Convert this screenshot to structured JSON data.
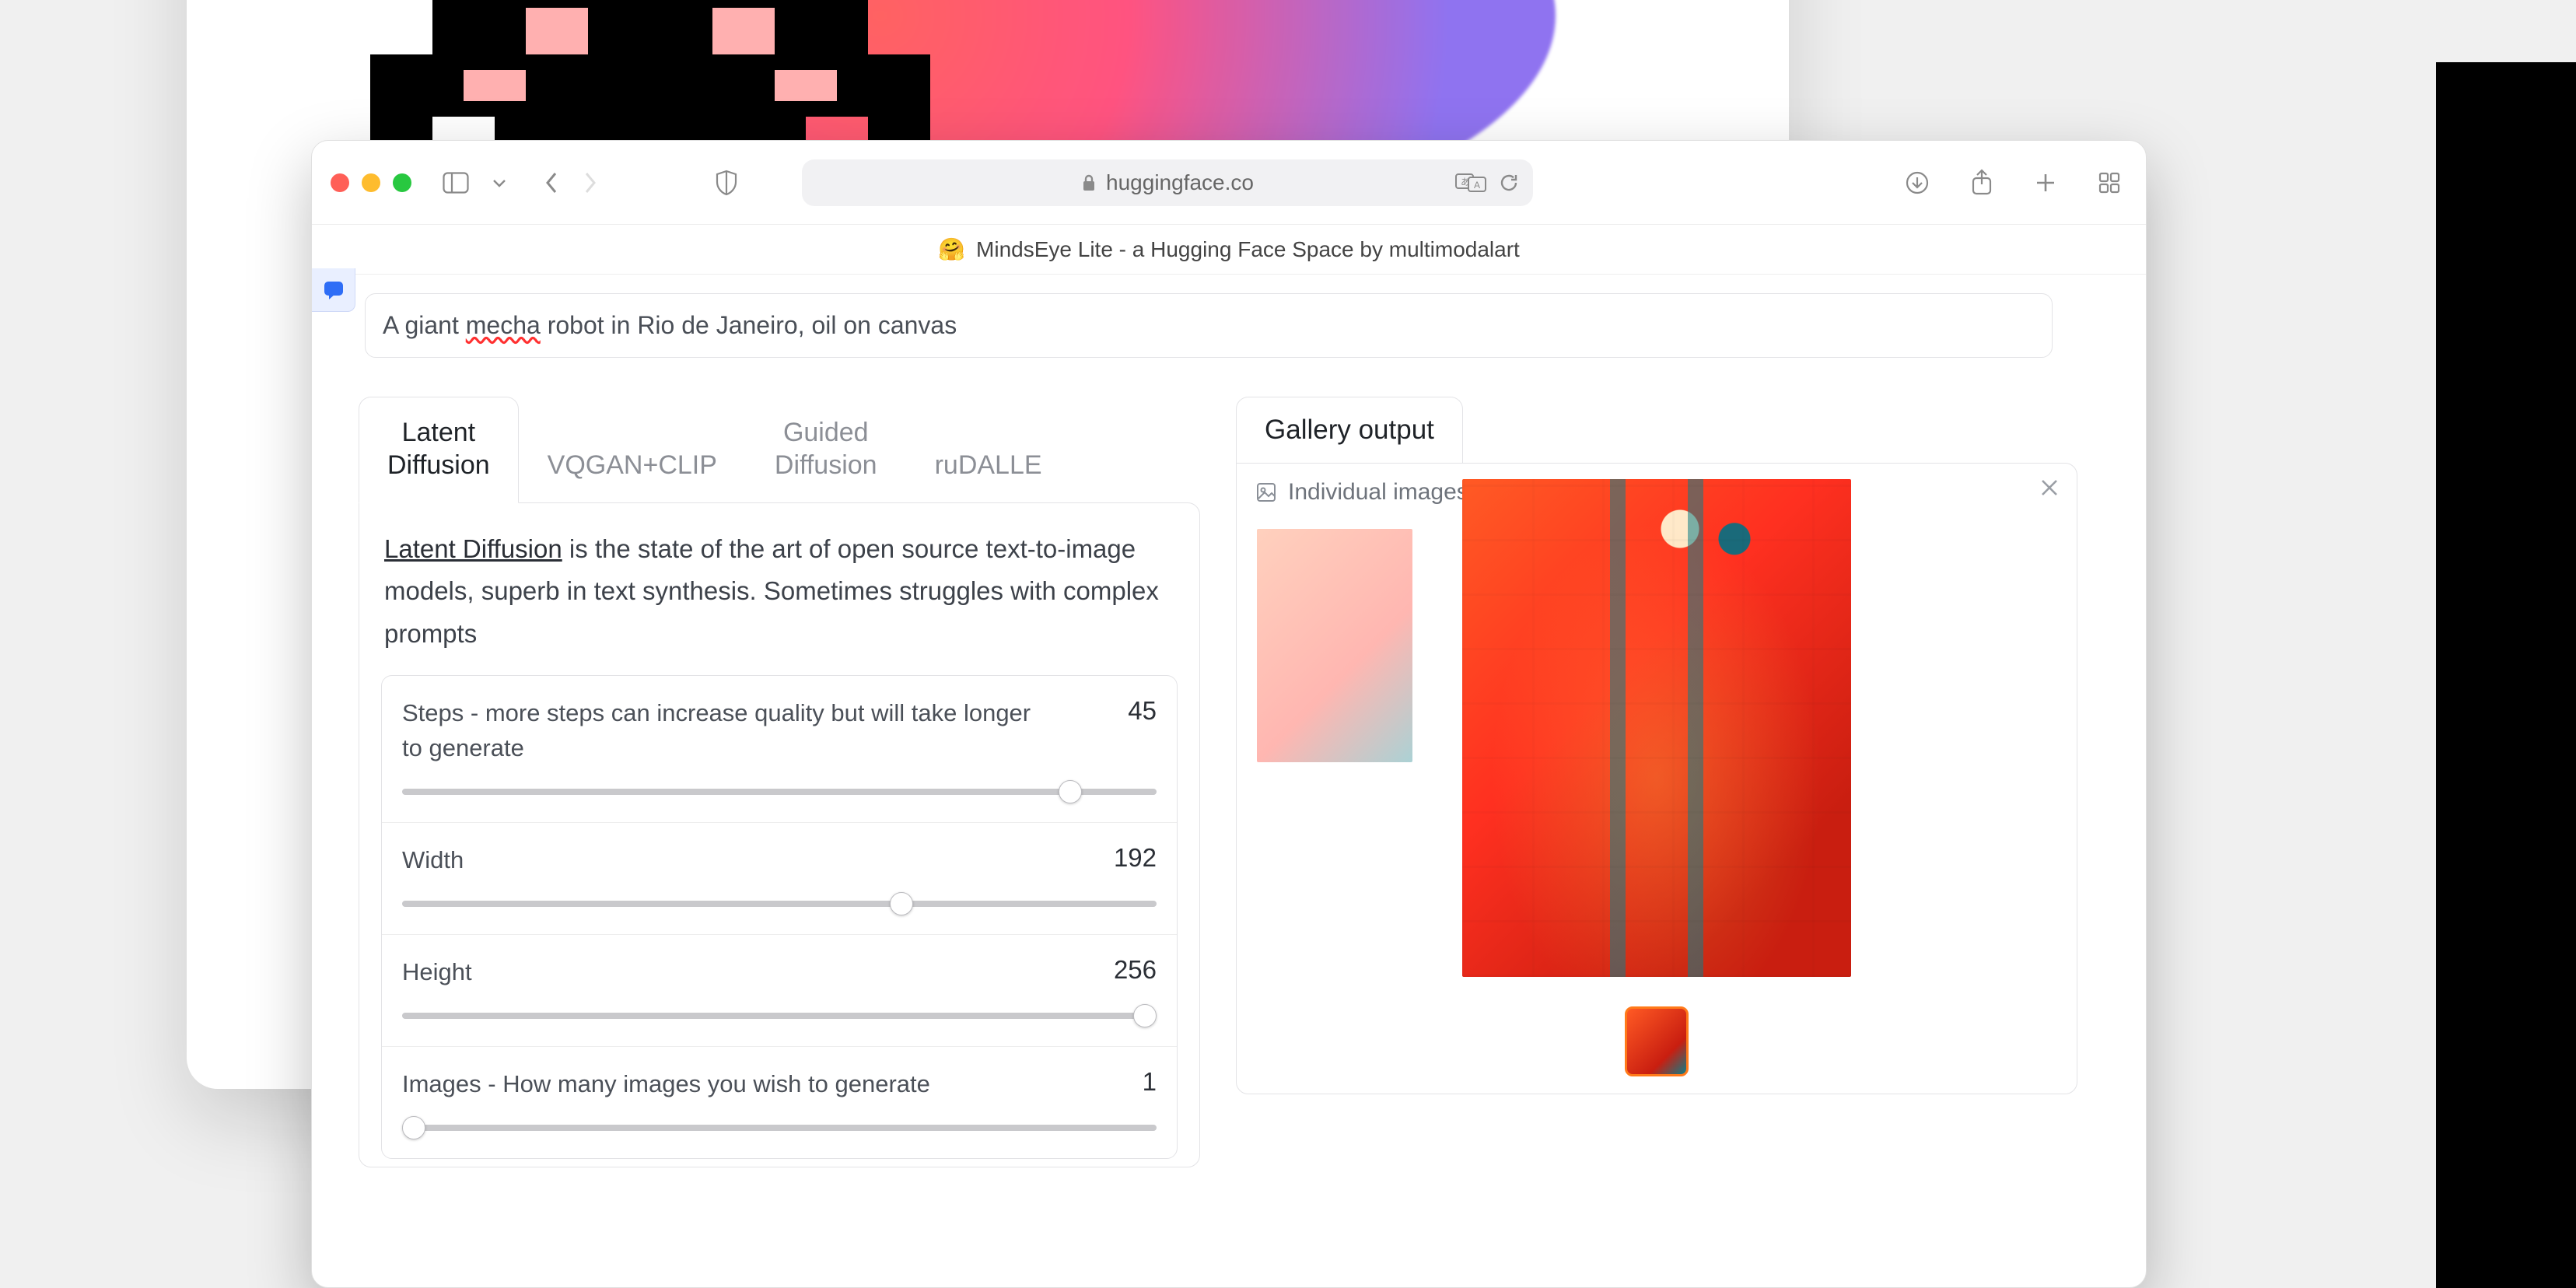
{
  "browser": {
    "url_host": "huggingface.co",
    "tab_title": "MindsEye Lite - a Hugging Face Space by multimodalart",
    "tab_emoji": "🤗"
  },
  "prompt": {
    "value": "A giant mecha robot in Rio de Janeiro, oil on canvas",
    "spell_word": "mecha"
  },
  "tabs": [
    {
      "label": "Latent\nDiffusion",
      "active": true
    },
    {
      "label": "VQGAN+CLIP",
      "active": false
    },
    {
      "label": "Guided\nDiffusion",
      "active": false
    },
    {
      "label": "ruDALLE",
      "active": false
    }
  ],
  "description": {
    "link_text": "Latent Diffusion",
    "rest": " is the state of the art of open source text-to-image models, superb in text synthesis. Sometimes struggles with complex prompts"
  },
  "sliders": {
    "steps": {
      "label": "Steps - more steps can increase quality but will take longer to generate",
      "value": 45,
      "min": 1,
      "max": 50
    },
    "width": {
      "label": "Width",
      "value": 192,
      "min": 64,
      "max": 256
    },
    "height": {
      "label": "Height",
      "value": 256,
      "min": 64,
      "max": 256
    },
    "images": {
      "label": "Images - How many images you wish to generate",
      "value": 1,
      "min": 1,
      "max": 8
    }
  },
  "gallery": {
    "tab_label": "Gallery output",
    "header_label": "Individual images"
  }
}
